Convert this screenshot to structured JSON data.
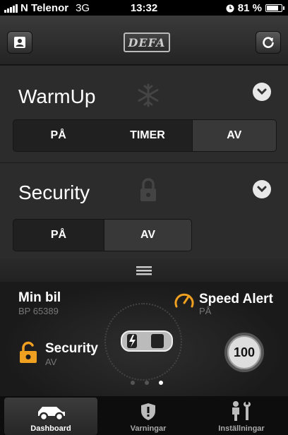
{
  "status_bar": {
    "carrier": "N Telenor",
    "network": "3G",
    "time": "13:32",
    "battery": "81 %"
  },
  "nav": {
    "logo_text": "DEFA",
    "left_icon": "contact-icon",
    "right_icon": "refresh-icon"
  },
  "warmup": {
    "title": "WarmUp",
    "icon": "snowflake-icon",
    "options": [
      "PÅ",
      "TIMER",
      "AV"
    ],
    "selected": "AV"
  },
  "security": {
    "title": "Security",
    "icon": "lock-icon",
    "options": [
      "PÅ",
      "AV"
    ],
    "selected": "AV"
  },
  "dashboard": {
    "car_label": "Min bil",
    "car_plate": "BP 65389",
    "speed_alert_label": "Speed Alert",
    "speed_alert_status": "PÅ",
    "security_label": "Security",
    "security_status": "AV",
    "speed_limit": "100",
    "page_count": 3,
    "current_page": 3
  },
  "tabs": [
    {
      "label": "Dashboard",
      "icon": "car-icon",
      "active": true
    },
    {
      "label": "Varningar",
      "icon": "shield-icon",
      "active": false
    },
    {
      "label": "Inställningar",
      "icon": "tools-icon",
      "active": false
    }
  ],
  "colors": {
    "accent_orange": "#f0a020",
    "background": "#2c2c2c"
  }
}
